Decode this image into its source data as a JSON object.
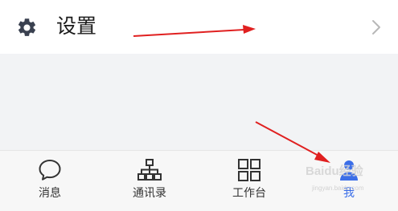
{
  "settings": {
    "label": "设置",
    "icon": "gear-icon"
  },
  "tabs": [
    {
      "label": "消息",
      "icon": "chat-bubble-icon",
      "active": false
    },
    {
      "label": "通讯录",
      "icon": "org-chart-icon",
      "active": false
    },
    {
      "label": "工作台",
      "icon": "grid-icon",
      "active": false
    },
    {
      "label": "我",
      "icon": "person-icon",
      "active": true
    }
  ],
  "watermark": {
    "text": "Baidu经验",
    "sub": "jingyan.baidu.com"
  },
  "colors": {
    "accent": "#3b6ee8",
    "annotation_arrow": "#e02020",
    "gear": "#3a4150"
  }
}
